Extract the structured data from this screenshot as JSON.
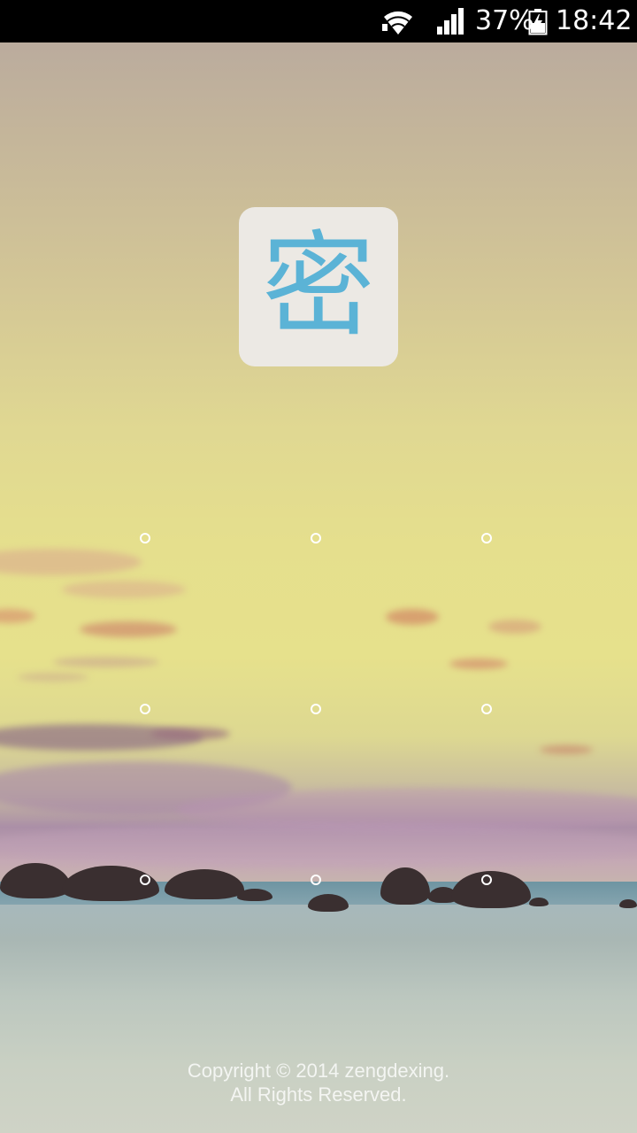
{
  "status_bar": {
    "battery_percent": "37%",
    "time": "18:42",
    "icons": [
      "wifi-icon",
      "signal-icon",
      "battery-charging-icon"
    ]
  },
  "app_logo": {
    "glyph": "密",
    "glyph_color": "#5bb3d6",
    "background_color": "#ece9e4"
  },
  "pattern_lock": {
    "rows": 3,
    "cols": 3,
    "dots": [
      {
        "id": "1"
      },
      {
        "id": "2"
      },
      {
        "id": "3"
      },
      {
        "id": "4"
      },
      {
        "id": "5"
      },
      {
        "id": "6"
      },
      {
        "id": "7"
      },
      {
        "id": "8"
      },
      {
        "id": "9"
      }
    ]
  },
  "footer": {
    "line1": "Copyright © 2014 zengdexing.",
    "line2": "All Rights Reserved."
  }
}
